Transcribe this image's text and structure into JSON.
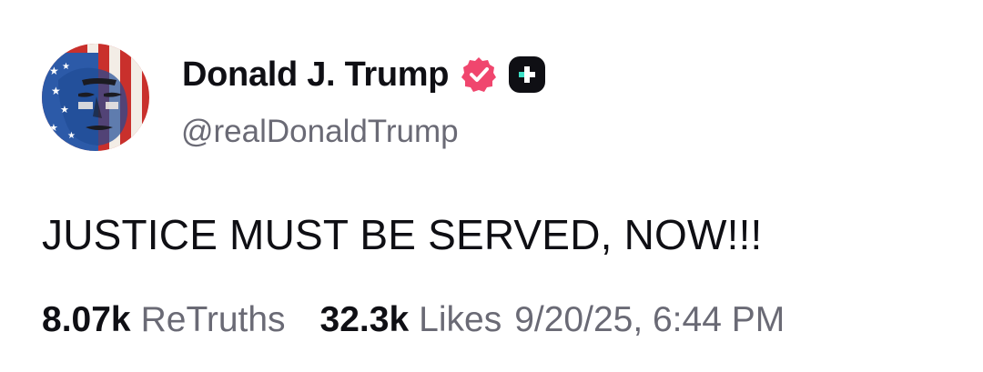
{
  "author": {
    "display_name": "Donald J. Trump",
    "handle": "@realDonaldTrump",
    "verified_color": "#f0466e",
    "avatar_icon": "flag-portrait-avatar"
  },
  "post": {
    "text": "JUSTICE MUST BE SERVED, NOW!!!"
  },
  "stats": {
    "retruths_count": "8.07k",
    "retruths_label": "ReTruths",
    "likes_count": "32.3k",
    "likes_label": "Likes",
    "timestamp": "9/20/25, 6:44 PM"
  },
  "colors": {
    "text_primary": "#0f0f14",
    "text_secondary": "#6a6a75",
    "plus_badge_bg": "#0f0f14",
    "plus_badge_accent": "#3ee0c6"
  }
}
